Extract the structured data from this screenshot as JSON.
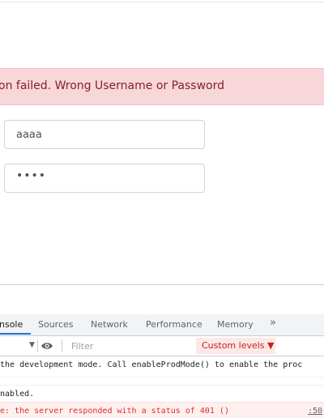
{
  "alert": {
    "message": "on failed. Wrong Username or Password"
  },
  "form": {
    "username_value": "aaaa",
    "password_value": "••••"
  },
  "devtools": {
    "tabs": [
      {
        "label": "nsole",
        "active": true
      },
      {
        "label": "Sources",
        "active": false
      },
      {
        "label": "Network",
        "active": false
      },
      {
        "label": "Performance",
        "active": false
      },
      {
        "label": "Memory",
        "active": false
      },
      {
        "label": "»",
        "active": false
      }
    ],
    "toolbar": {
      "dropdown_arrow": "▼",
      "filter_placeholder": "Filter",
      "levels_label": "Custom levels ▼"
    },
    "console": {
      "line1": "the development mode. Call enableProdMode() to enable the proc",
      "line2": "nabled.",
      "line3": "e: the server responded with a status of 401 ()",
      "line3_source": ":50"
    }
  },
  "colors": {
    "alert_bg": "#f8d7da",
    "alert_text": "#842029",
    "error_text": "#d93025",
    "active_tab_accent": "#1a73e8"
  }
}
